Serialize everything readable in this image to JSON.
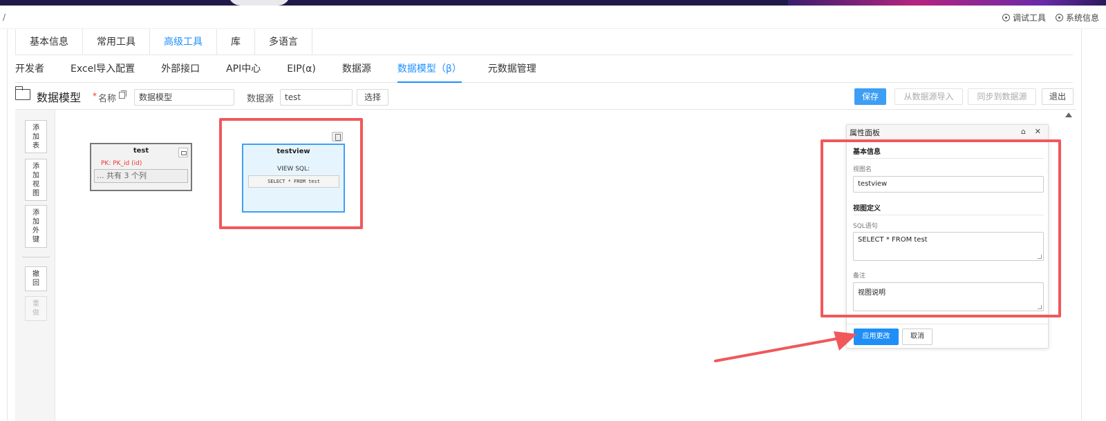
{
  "topbar": {
    "breadcrumb": "/",
    "debug_tool": "调试工具",
    "system_info": "系统信息"
  },
  "main_tabs": [
    {
      "label": "基本信息",
      "active": false
    },
    {
      "label": "常用工具",
      "active": false
    },
    {
      "label": "高级工具",
      "active": true
    },
    {
      "label": "库",
      "active": false
    },
    {
      "label": "多语言",
      "active": false
    }
  ],
  "sub_tabs": [
    {
      "label": "开发者",
      "active": false
    },
    {
      "label": "Excel导入配置",
      "active": false
    },
    {
      "label": "外部接口",
      "active": false
    },
    {
      "label": "API中心",
      "active": false
    },
    {
      "label": "EIP(α)",
      "active": false
    },
    {
      "label": "数据源",
      "active": false
    },
    {
      "label": "数据模型（β）",
      "active": true
    },
    {
      "label": "元数据管理",
      "active": false
    }
  ],
  "toolbar": {
    "title": "数据模型",
    "required_mark": "*",
    "name_label": "名称",
    "name_value": "数据模型",
    "datasource_label": "数据源",
    "datasource_value": "test",
    "select_button": "选择",
    "save_button": "保存",
    "import_button": "从数据源导入",
    "sync_button": "同步到数据源",
    "exit_button": "退出"
  },
  "left_tools": {
    "add_table": "添\n加\n表",
    "add_view": "添\n加\n视\n图",
    "add_fk": "添\n加\n外\n键",
    "undo": "撤\n回",
    "redo": "重\n做"
  },
  "canvas": {
    "table": {
      "name": "test",
      "pk": "PK: PK_id (id)",
      "columns_summary": "... 共有 3 个列"
    },
    "view": {
      "name": "testview",
      "sql_heading": "VIEW SQL:",
      "sql": "SELECT * FROM test"
    }
  },
  "property_panel": {
    "title": "属性面板",
    "section_basic": "基本信息",
    "view_name_label": "视图名",
    "view_name_value": "testview",
    "section_definition": "视图定义",
    "sql_label": "SQL语句",
    "sql_value": "SELECT * FROM test",
    "remark_label": "备注",
    "remark_value": "视图说明",
    "apply_button": "应用更改",
    "cancel_button": "取消"
  },
  "colors": {
    "accent": "#1e90ff",
    "primary_button": "#3d9ef5",
    "highlight_annotation": "#f0585a"
  }
}
